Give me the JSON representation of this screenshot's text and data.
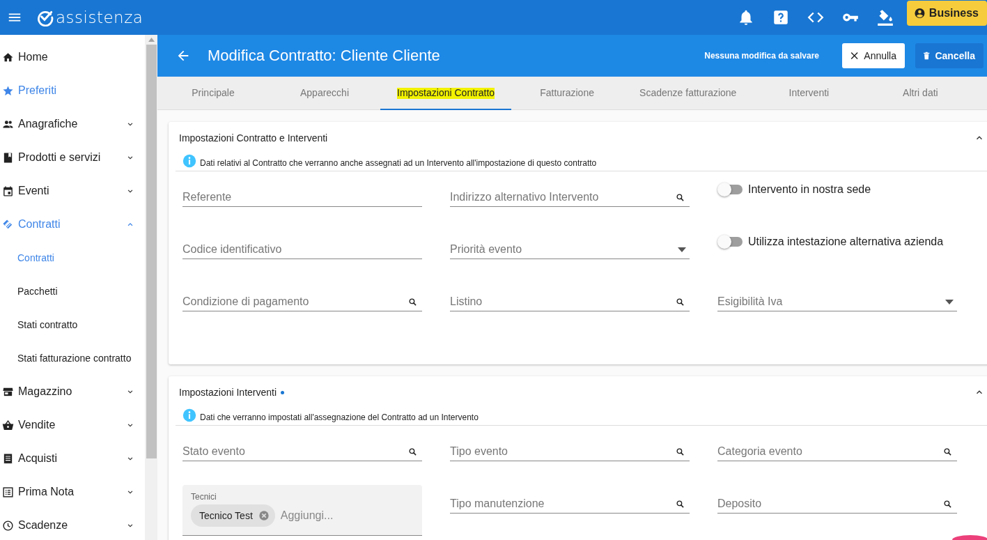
{
  "topbar": {
    "logo_text": "assistenza",
    "account_label": "Business"
  },
  "sidebar": {
    "items": [
      {
        "label": "Home",
        "kind": "link",
        "selected": false
      },
      {
        "label": "Preferiti",
        "kind": "link",
        "selected": true
      },
      {
        "label": "Anagrafiche",
        "kind": "group",
        "expanded": false,
        "selected": false
      },
      {
        "label": "Prodotti e servizi",
        "kind": "group",
        "expanded": false,
        "selected": false
      },
      {
        "label": "Eventi",
        "kind": "group",
        "expanded": false,
        "selected": false
      },
      {
        "label": "Contratti",
        "kind": "group",
        "expanded": true,
        "selected": true,
        "children": [
          {
            "label": "Contratti",
            "selected": true
          },
          {
            "label": "Pacchetti",
            "selected": false
          },
          {
            "label": "Stati contratto",
            "selected": false
          },
          {
            "label": "Stati fatturazione contratto",
            "selected": false
          }
        ]
      },
      {
        "label": "Magazzino",
        "kind": "group",
        "expanded": false,
        "selected": false
      },
      {
        "label": "Vendite",
        "kind": "group",
        "expanded": false,
        "selected": false
      },
      {
        "label": "Acquisti",
        "kind": "group",
        "expanded": false,
        "selected": false
      },
      {
        "label": "Prima Nota",
        "kind": "group",
        "expanded": false,
        "selected": false
      },
      {
        "label": "Scadenze",
        "kind": "group",
        "expanded": false,
        "selected": false
      }
    ]
  },
  "header": {
    "title": "Modifica Contratto: Cliente Cliente",
    "status": "Nessuna modifica da salvare",
    "buttons": [
      {
        "label": "Annulla",
        "kind": "cancel"
      },
      {
        "label": "Cancella",
        "kind": "delete"
      }
    ]
  },
  "tabs": [
    {
      "label": "Principale",
      "selected": false,
      "highlighted": false
    },
    {
      "label": "Apparecchi",
      "selected": false,
      "highlighted": false
    },
    {
      "label": "Impostazioni Contratto",
      "selected": true,
      "highlighted": true
    },
    {
      "label": "Fatturazione",
      "selected": false,
      "highlighted": false
    },
    {
      "label": "Scadenze fatturazione",
      "selected": false,
      "highlighted": false
    },
    {
      "label": "Interventi",
      "selected": false,
      "highlighted": false
    },
    {
      "label": "Altri dati",
      "selected": false,
      "highlighted": false
    }
  ],
  "sections": [
    {
      "title": "Impostazioni Contratto e Interventi",
      "modified": false,
      "expanded": true,
      "info": "Dati relativi al Contratto che verranno anche assegnati ad un Intervento all'impostazione di questo contratto",
      "fields": [
        {
          "kind": "text",
          "placeholder": "Referente"
        },
        {
          "kind": "search",
          "placeholder": "Indirizzo alternativo Intervento"
        },
        {
          "kind": "toggle",
          "label": "Intervento in nostra sede",
          "on": false
        },
        {
          "kind": "text",
          "placeholder": "Codice identificativo"
        },
        {
          "kind": "select",
          "placeholder": "Priorità evento"
        },
        {
          "kind": "toggle",
          "label": "Utilizza intestazione alternativa azienda",
          "on": false
        },
        {
          "kind": "search",
          "placeholder": "Condizione di pagamento"
        },
        {
          "kind": "search",
          "placeholder": "Listino"
        },
        {
          "kind": "select",
          "placeholder": "Esigibilità Iva"
        }
      ]
    },
    {
      "title": "Impostazioni Interventi",
      "modified": true,
      "expanded": true,
      "info": "Dati che verranno impostati all'assegnazione del Contratto ad un Intervento",
      "fields": [
        {
          "kind": "search",
          "placeholder": "Stato evento"
        },
        {
          "kind": "search",
          "placeholder": "Tipo evento"
        },
        {
          "kind": "search",
          "placeholder": "Categoria evento"
        },
        {
          "kind": "chips",
          "label": "Tecnici",
          "chips": [
            "Tecnico Test"
          ],
          "placeholder": "Aggiungi..."
        },
        {
          "kind": "search",
          "placeholder": "Tipo manutenzione"
        },
        {
          "kind": "search",
          "placeholder": "Deposito"
        }
      ]
    }
  ]
}
